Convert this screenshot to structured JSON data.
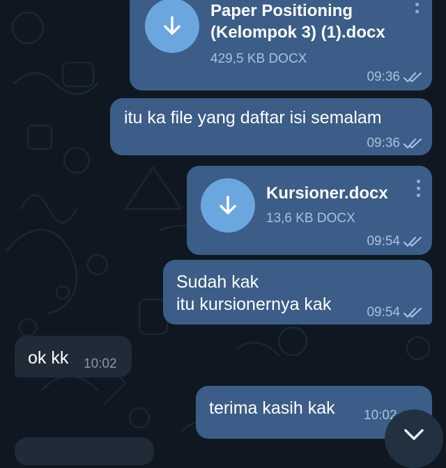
{
  "colors": {
    "chat_background": "#0f1820",
    "outgoing_bubble": "#3b5d87",
    "incoming_bubble": "#1f2b37",
    "download_accent": "#6ca6de",
    "read_check": "#a7c2df"
  },
  "messages": [
    {
      "direction": "outgoing",
      "type": "file",
      "file_name_line1": "Paper Positioning",
      "file_name_line2": "(Kelompok 3) (1).docx",
      "file_size": "429,5 KB DOCX",
      "time": "09:36",
      "icon": "download-arrow-icon",
      "status_icon": "double-check-icon"
    },
    {
      "direction": "outgoing",
      "type": "text",
      "text": "itu ka file yang daftar isi semalam",
      "time": "09:36",
      "status_icon": "double-check-icon"
    },
    {
      "direction": "outgoing",
      "type": "file",
      "file_name": "Kursioner.docx",
      "file_size": "13,6 KB DOCX",
      "time": "09:54",
      "icon": "download-arrow-icon",
      "status_icon": "double-check-icon"
    },
    {
      "direction": "outgoing",
      "type": "text",
      "text_line1": "Sudah kak",
      "text_line2": "itu kursionernya kak",
      "time": "09:54",
      "status_icon": "double-check-icon"
    },
    {
      "direction": "incoming",
      "type": "text",
      "text": "ok kk",
      "time": "10:02"
    },
    {
      "direction": "outgoing",
      "type": "text",
      "text": "terima kasih kak",
      "time": "10:02",
      "status_icon": "double-check-icon"
    }
  ],
  "scroll_button": {
    "icon": "chevron-down-icon"
  }
}
